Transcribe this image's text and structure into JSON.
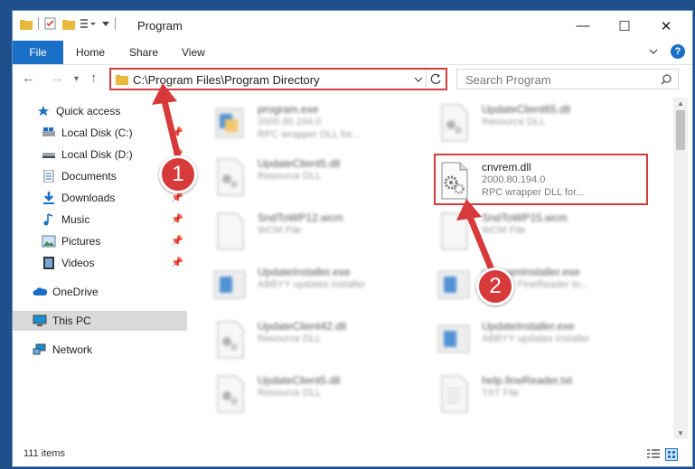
{
  "window": {
    "title": "Program",
    "minimize": "—",
    "maximize": "☐",
    "close": "✕"
  },
  "ribbon": {
    "file": "File",
    "tabs": [
      "Home",
      "Share",
      "View"
    ]
  },
  "address": {
    "path": "C:\\Program Files\\Program Directory"
  },
  "search": {
    "placeholder": "Search Program"
  },
  "sidebar": {
    "items": [
      {
        "label": "Quick access",
        "icon": "star-icon",
        "pinned": false
      },
      {
        "label": "Local Disk (C:)",
        "icon": "drive-icon",
        "pinned": true
      },
      {
        "label": "Local Disk (D:)",
        "icon": "drive-icon",
        "pinned": true
      },
      {
        "label": "Documents",
        "icon": "documents-icon",
        "pinned": true
      },
      {
        "label": "Downloads",
        "icon": "downloads-icon",
        "pinned": true
      },
      {
        "label": "Music",
        "icon": "music-icon",
        "pinned": true
      },
      {
        "label": "Pictures",
        "icon": "pictures-icon",
        "pinned": true
      },
      {
        "label": "Videos",
        "icon": "videos-icon",
        "pinned": true
      },
      {
        "label": "OneDrive",
        "icon": "onedrive-icon",
        "pinned": false
      },
      {
        "label": "This PC",
        "icon": "this-pc-icon",
        "pinned": false
      },
      {
        "label": "Network",
        "icon": "network-icon",
        "pinned": false
      }
    ]
  },
  "files": [
    {
      "name": "program.exe",
      "line2": "2000.80.194.0",
      "line3": "RPC wrapper DLL for...",
      "icon": "exe-icon"
    },
    {
      "name": "UpdateClient65.dll",
      "line2": "Resource DLL",
      "line3": "",
      "icon": "dll-icon"
    },
    {
      "name": "UpdateClient5.dll",
      "line2": "Resource DLL",
      "line3": "",
      "icon": "dll-icon"
    },
    {
      "name": "cnvrem.dll",
      "line2": "2000.80.194.0",
      "line3": "RPC wrapper DLL for...",
      "icon": "dll-icon"
    },
    {
      "name": "SndToWP12.wcm",
      "line2": "WCM File",
      "line3": "",
      "icon": "file-icon"
    },
    {
      "name": "SndToWP15.wcm",
      "line2": "WCM File",
      "line3": "",
      "icon": "file-icon"
    },
    {
      "name": "UpdateInstaller.exe",
      "line2": "ABBYY updates installer",
      "line3": "",
      "icon": "installer-icon"
    },
    {
      "name": "programInstaller.exe",
      "line2": "ABBYY FineReader to...",
      "line3": "",
      "icon": "installer-icon"
    },
    {
      "name": "UpdateClient42.dll",
      "line2": "Resource DLL",
      "line3": "",
      "icon": "dll-icon"
    },
    {
      "name": "UpdateInstaller.exe",
      "line2": "ABBYY updates installer",
      "line3": "",
      "icon": "installer-icon"
    },
    {
      "name": "UpdateClient5.dll",
      "line2": "Resource DLL",
      "line3": "",
      "icon": "dll-icon"
    },
    {
      "name": "help.fineReader.txt",
      "line2": "TXT File",
      "line3": "",
      "icon": "txt-icon"
    }
  ],
  "status": {
    "count": "111 items"
  },
  "annotations": {
    "step1": "1",
    "step2": "2"
  },
  "colors": {
    "accent": "#1a6fc6",
    "highlight": "#d43d3d",
    "desktop": "#1f4f8a"
  }
}
